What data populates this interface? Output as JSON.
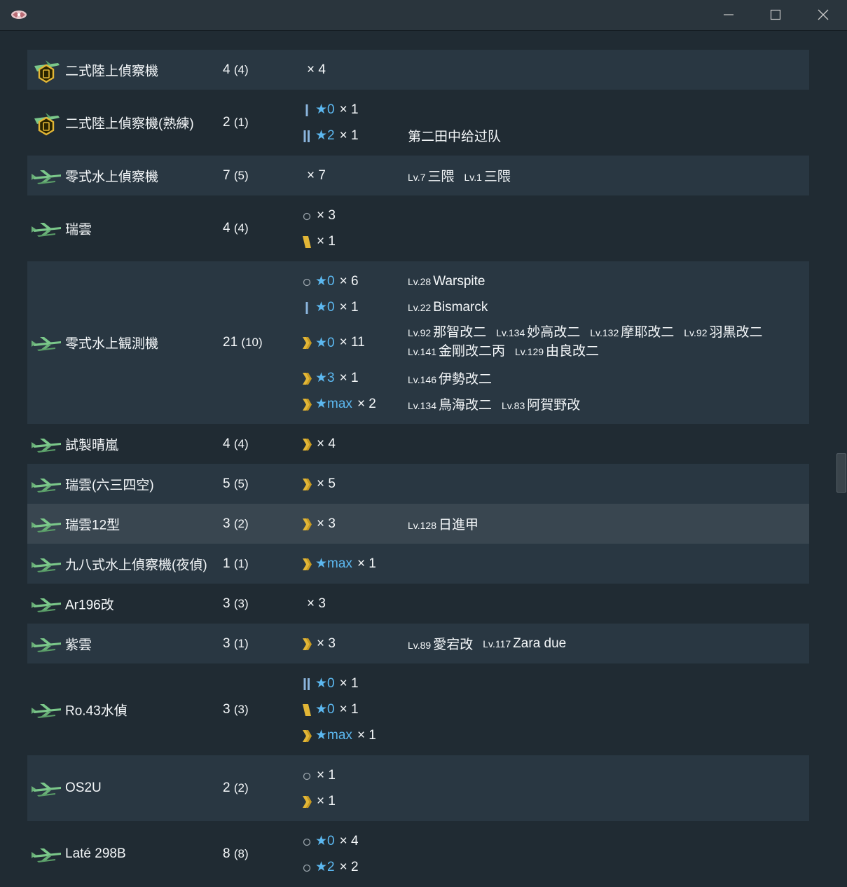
{
  "window": {
    "app_icon": "sakura-logo-icon",
    "controls": [
      {
        "name": "minimize",
        "icon": "minimize-icon"
      },
      {
        "name": "maximize",
        "icon": "maximize-icon"
      },
      {
        "name": "close",
        "icon": "close-icon"
      }
    ]
  },
  "colors": {
    "background": "#202b33",
    "row_alt": "#293742",
    "row_highlight": "#394650",
    "star": "#5cb8f0",
    "proficiency_gold": "#e2b636",
    "proficiency_blue": "#8ab4dc",
    "plane_green": "#7bc88a"
  },
  "equipment": [
    {
      "name": "二式陸上偵察機",
      "icon": "land-recon-badge-icon",
      "count": "4",
      "available": "(4)",
      "lines": [
        {
          "mark": "none",
          "star": "",
          "qty": "× 4",
          "ships": []
        }
      ]
    },
    {
      "name": "二式陸上偵察機(熟練)",
      "icon": "land-recon-badge-icon",
      "count": "2",
      "available": "(1)",
      "lines": [
        {
          "mark": "prof-1",
          "star": "★0",
          "qty": "× 1",
          "ships": []
        },
        {
          "mark": "prof-2",
          "star": "★2",
          "qty": "× 1",
          "ships": [],
          "fleet": "第二田中给过队"
        }
      ]
    },
    {
      "name": "零式水上偵察機",
      "icon": "seaplane-icon",
      "count": "7",
      "available": "(5)",
      "lines": [
        {
          "mark": "none",
          "star": "",
          "qty": "× 7",
          "ships": [
            {
              "lv": "Lv.7",
              "name": "三隈"
            },
            {
              "lv": "Lv.1",
              "name": "三隈"
            }
          ]
        }
      ]
    },
    {
      "name": "瑞雲",
      "icon": "seaplane-icon",
      "count": "4",
      "available": "(4)",
      "lines": [
        {
          "mark": "circle",
          "star": "",
          "qty": "× 3",
          "ships": []
        },
        {
          "mark": "prof-4",
          "star": "",
          "qty": "× 1",
          "ships": []
        }
      ]
    },
    {
      "name": "零式水上観測機",
      "icon": "seaplane-icon",
      "count": "21",
      "available": "(10)",
      "lines": [
        {
          "mark": "circle",
          "star": "★0",
          "qty": "× 6",
          "ships": [
            {
              "lv": "Lv.28",
              "name": "Warspite"
            }
          ]
        },
        {
          "mark": "prof-1",
          "star": "★0",
          "qty": "× 1",
          "ships": [
            {
              "lv": "Lv.22",
              "name": "Bismarck"
            }
          ]
        },
        {
          "mark": "prof-max",
          "star": "★0",
          "qty": "× 11",
          "ships": [
            {
              "lv": "Lv.92",
              "name": "那智改二"
            },
            {
              "lv": "Lv.134",
              "name": "妙高改二"
            },
            {
              "lv": "Lv.132",
              "name": "摩耶改二"
            },
            {
              "lv": "Lv.92",
              "name": "羽黒改二"
            },
            {
              "lv": "Lv.141",
              "name": "金剛改二丙"
            },
            {
              "lv": "Lv.129",
              "name": "由良改二"
            }
          ]
        },
        {
          "mark": "prof-max",
          "star": "★3",
          "qty": "× 1",
          "ships": [
            {
              "lv": "Lv.146",
              "name": "伊勢改二"
            }
          ]
        },
        {
          "mark": "prof-max",
          "star": "★max",
          "qty": "× 2",
          "ships": [
            {
              "lv": "Lv.134",
              "name": "鳥海改二"
            },
            {
              "lv": "Lv.83",
              "name": "阿賀野改"
            }
          ]
        }
      ]
    },
    {
      "name": "試製晴嵐",
      "icon": "seaplane-icon",
      "count": "4",
      "available": "(4)",
      "lines": [
        {
          "mark": "prof-max",
          "star": "",
          "qty": "× 4",
          "ships": []
        }
      ]
    },
    {
      "name": "瑞雲(六三四空)",
      "icon": "seaplane-icon",
      "count": "5",
      "available": "(5)",
      "lines": [
        {
          "mark": "prof-max",
          "star": "",
          "qty": "× 5",
          "ships": []
        }
      ]
    },
    {
      "name": "瑞雲12型",
      "icon": "seaplane-icon",
      "count": "3",
      "available": "(2)",
      "highlighted": true,
      "lines": [
        {
          "mark": "prof-max",
          "star": "",
          "qty": "× 3",
          "ships": [
            {
              "lv": "Lv.128",
              "name": "日進甲"
            }
          ]
        }
      ]
    },
    {
      "name": "九八式水上偵察機(夜偵)",
      "icon": "seaplane-icon",
      "count": "1",
      "available": "(1)",
      "lines": [
        {
          "mark": "prof-max",
          "star": "★max",
          "qty": "× 1",
          "ships": []
        }
      ]
    },
    {
      "name": "Ar196改",
      "icon": "seaplane-icon",
      "count": "3",
      "available": "(3)",
      "lines": [
        {
          "mark": "none",
          "star": "",
          "qty": "× 3",
          "ships": []
        }
      ]
    },
    {
      "name": "紫雲",
      "icon": "seaplane-icon",
      "count": "3",
      "available": "(1)",
      "lines": [
        {
          "mark": "prof-max",
          "star": "",
          "qty": "× 3",
          "ships": [
            {
              "lv": "Lv.89",
              "name": "愛宕改"
            },
            {
              "lv": "Lv.117",
              "name": "Zara due"
            }
          ]
        }
      ]
    },
    {
      "name": "Ro.43水偵",
      "icon": "seaplane-icon",
      "count": "3",
      "available": "(3)",
      "lines": [
        {
          "mark": "prof-2",
          "star": "★0",
          "qty": "× 1",
          "ships": []
        },
        {
          "mark": "prof-4",
          "star": "★0",
          "qty": "× 1",
          "ships": []
        },
        {
          "mark": "prof-max",
          "star": "★max",
          "qty": "× 1",
          "ships": []
        }
      ]
    },
    {
      "name": "OS2U",
      "icon": "seaplane-icon",
      "count": "2",
      "available": "(2)",
      "lines": [
        {
          "mark": "circle",
          "star": "",
          "qty": "× 1",
          "ships": []
        },
        {
          "mark": "prof-max",
          "star": "",
          "qty": "× 1",
          "ships": []
        }
      ]
    },
    {
      "name": "Laté 298B",
      "icon": "seaplane-icon",
      "count": "8",
      "available": "(8)",
      "lines": [
        {
          "mark": "circle",
          "star": "★0",
          "qty": "× 4",
          "ships": []
        },
        {
          "mark": "circle",
          "star": "★2",
          "qty": "× 2",
          "ships": []
        }
      ]
    }
  ]
}
